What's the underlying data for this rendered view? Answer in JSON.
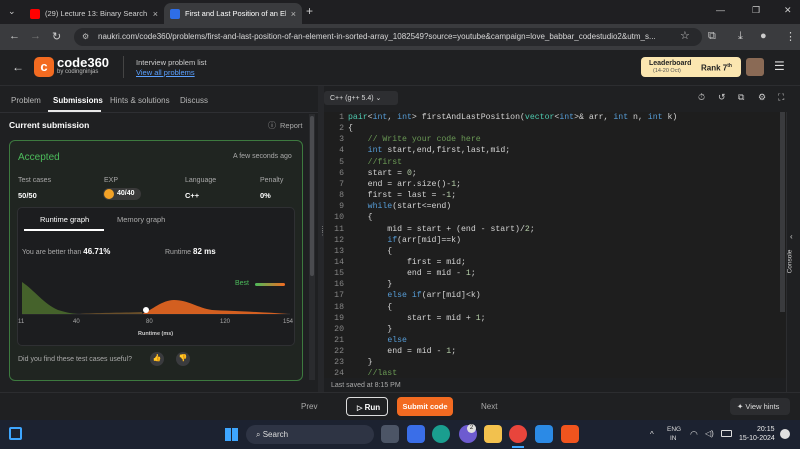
{
  "browser": {
    "tabs": [
      {
        "title": "(29) Lecture 13: Binary Search |",
        "active": false,
        "favicon_color": "#ff0000"
      },
      {
        "title": "First and Last Position of an Ele",
        "active": true,
        "favicon_color": "#2e6ee8"
      }
    ],
    "new_tab": "+",
    "url": "naukri.com/code360/problems/first-and-last-position-of-an-element-in-sorted-array_1082549?source=youtube&campaign=love_babbar_codestudio2&utm_s..."
  },
  "header": {
    "logo_text": "code360",
    "logo_sub": "by codingninjas",
    "list_title": "Interview problem list",
    "list_link": "View all problems",
    "leaderboard": "Leaderboard",
    "leaderboard_dates": "(14-20 Oct)",
    "rank": "Rank 7",
    "rank_sup": "th"
  },
  "left_tabs": [
    "Problem",
    "Submissions",
    "Hints & solutions",
    "Discuss"
  ],
  "submission": {
    "title": "Current submission",
    "report": "Report",
    "status": "Accepted",
    "time": "A few seconds ago",
    "test_cases_label": "Test cases",
    "test_cases": "50/50",
    "exp_label": "EXP",
    "exp": "40/40",
    "language_label": "Language",
    "language": "C++",
    "penalty_label": "Penalty",
    "penalty": "0%",
    "graph_tabs": [
      "Runtime graph",
      "Memory graph"
    ],
    "better_prefix": "You are better than",
    "better_value": "46.71%",
    "runtime_label": "Runtime",
    "runtime_value": "82 ms",
    "best_label": "Best",
    "axis_title": "Runtime (ms)",
    "feedback": "Did you find these test cases useful?"
  },
  "chart_data": {
    "type": "area",
    "x_ticks": [
      "11",
      "40",
      "80",
      "120",
      "154"
    ],
    "xlabel": "Runtime (ms)",
    "marker_x": 82
  },
  "editor": {
    "language": "C++ (g++ 5.4)",
    "saved": "Last saved at 8:15 PM",
    "lines": [
      "pair<int, int> firstAndLastPosition(vector<int>& arr, int n, int k)",
      "{",
      "    // Write your code here",
      "    int start,end,first,last,mid;",
      "    //first",
      "    start = 0;",
      "    end = arr.size()-1;",
      "    first = last = -1;",
      "    while(start<=end)",
      "    {",
      "        mid = start + (end - start)/2;",
      "        if(arr[mid]==k)",
      "        {",
      "            first = mid;",
      "            end = mid - 1;",
      "        }",
      "        else if(arr[mid]<k)",
      "        {",
      "            start = mid + 1;",
      "        }",
      "        else",
      "        end = mid - 1;",
      "    }",
      "    //last"
    ],
    "console": "Console"
  },
  "bottom": {
    "prev": "Prev",
    "run": "Run",
    "submit": "Submit code",
    "next": "Next",
    "hints": "View hints"
  },
  "taskbar": {
    "search": "Search",
    "lang1": "ENG",
    "lang2": "IN",
    "time": "20:15",
    "date": "15-10-2024",
    "badge": "2"
  }
}
